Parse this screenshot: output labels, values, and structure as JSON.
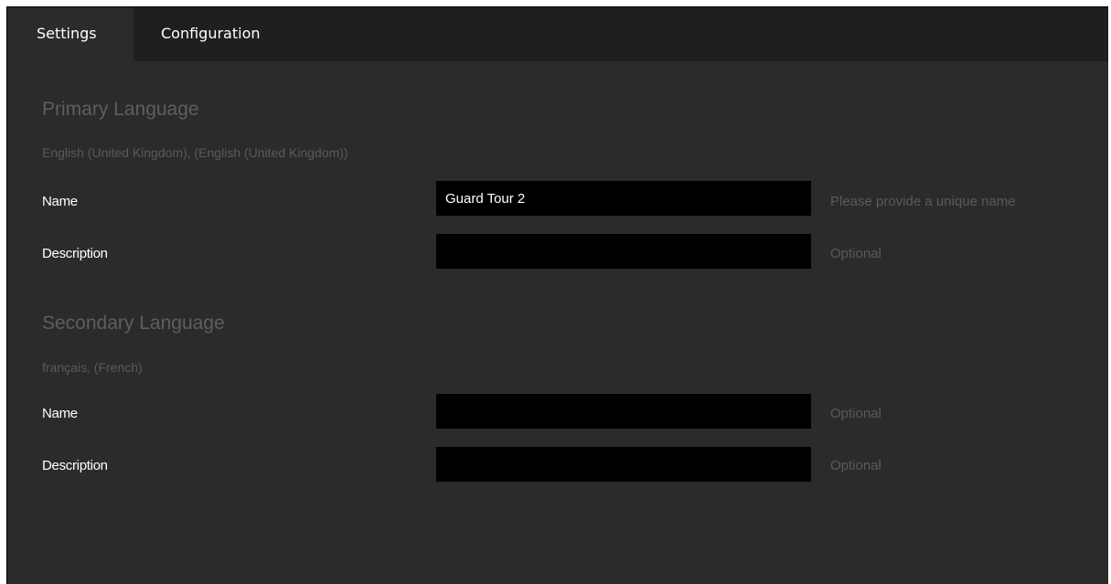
{
  "tabs": [
    {
      "label": "Settings",
      "active": true
    },
    {
      "label": "Configuration",
      "active": false
    }
  ],
  "primary": {
    "title": "Primary Language",
    "language": "English (United Kingdom), (English (United Kingdom))",
    "name_label": "Name",
    "name_value": "Guard Tour 2",
    "name_hint": "Please provide a unique name",
    "description_label": "Description",
    "description_value": "",
    "description_hint": "Optional"
  },
  "secondary": {
    "title": "Secondary Language",
    "language": "français, (French)",
    "name_label": "Name",
    "name_value": "",
    "name_hint": "Optional",
    "description_label": "Description",
    "description_value": "",
    "description_hint": "Optional"
  },
  "colors": {
    "background": "#2b2b2b",
    "tabbar": "#1f1f1f",
    "field": "#000000",
    "muted_text": "#5a5a5a"
  }
}
